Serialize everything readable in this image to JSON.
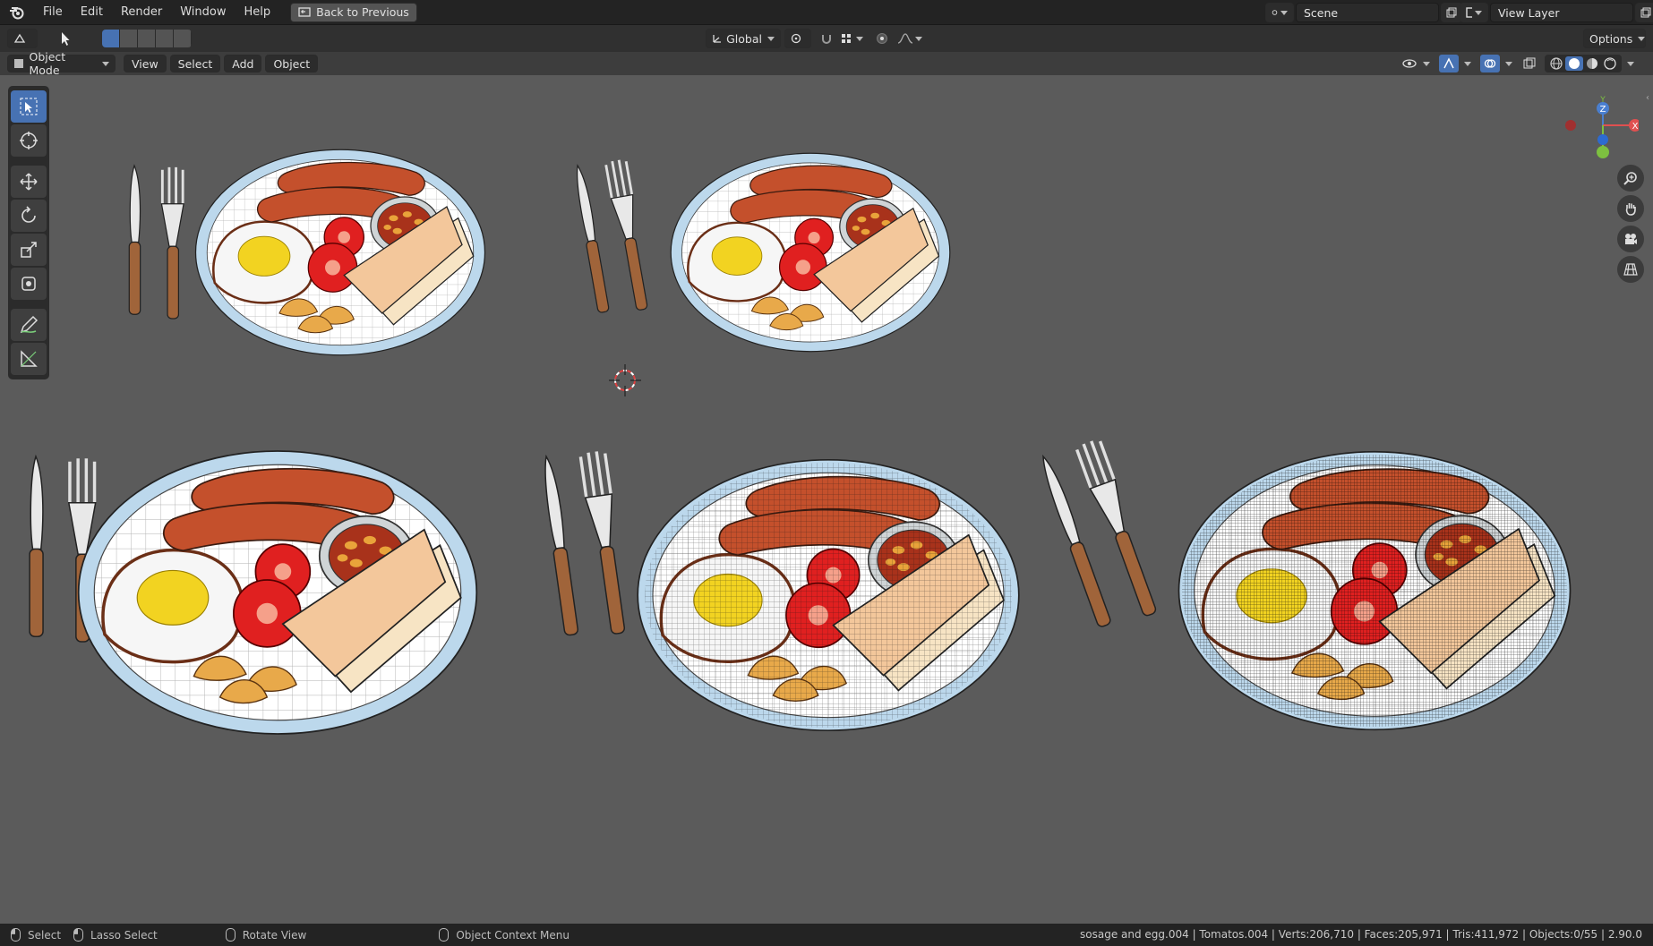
{
  "menu": {
    "items": [
      "File",
      "Edit",
      "Render",
      "Window",
      "Help"
    ],
    "back_button": "Back to Previous"
  },
  "scene": {
    "name": "Scene",
    "view_layer": "View Layer"
  },
  "header": {
    "transform_orientation": "Global",
    "options": "Options"
  },
  "viewport_header": {
    "mode": "Object Mode",
    "menus": [
      "View",
      "Select",
      "Add",
      "Object"
    ]
  },
  "gizmo": {
    "z": "Z",
    "y": "Y",
    "x": "X"
  },
  "statusbar": {
    "select": "Select",
    "lasso": "Lasso Select",
    "rotate": "Rotate View",
    "context": "Object Context Menu",
    "stats": "sosage and egg.004 | Tomatos.004 | Verts:206,710 | Faces:205,971 | Tris:411,972 | Objects:0/55 | 2.90.0"
  },
  "colors": {
    "viewport": "#5b5b5b",
    "accent": "#4772b3",
    "sausage": "#c4502c",
    "tomato": "#e02020",
    "egg_yolk": "#f2d321",
    "toast": "#f3c79b",
    "plate_rim": "#bcd8ec"
  }
}
